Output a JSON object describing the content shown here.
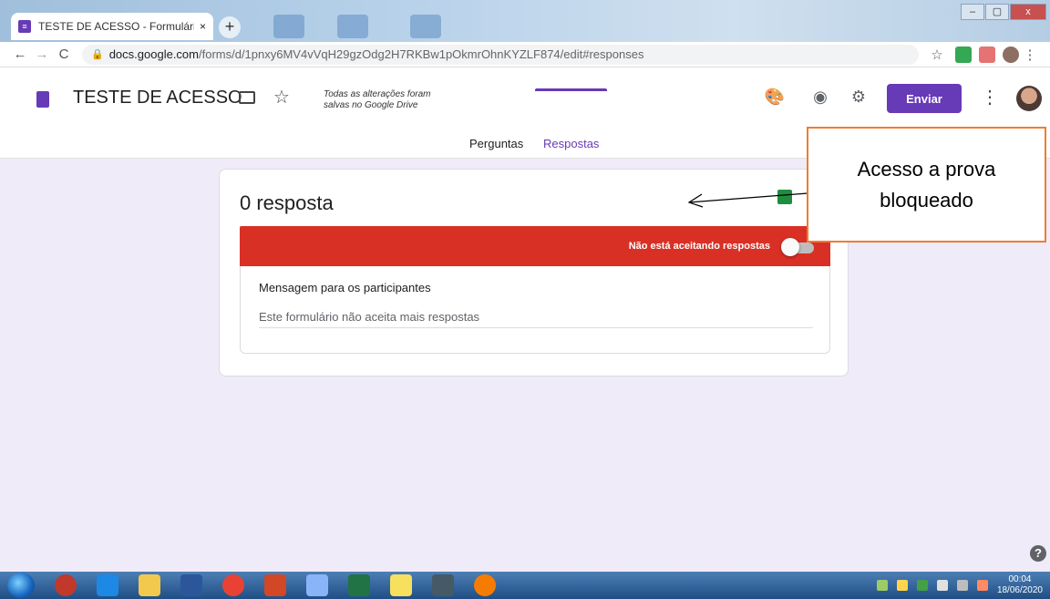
{
  "browser": {
    "tab_title": "TESTE DE ACESSO - Formulários (",
    "tab_close": "×",
    "new_tab": "+",
    "url_host": "docs.google.com",
    "url_path": "/forms/d/1pnxy6MV4vVqH29gzOdg2H7RKBw1pOkmrOhnKYZLF874/edit#responses",
    "window_buttons": {
      "minimize": "–",
      "maximize": "▢",
      "close": "x"
    }
  },
  "form": {
    "title": "TESTE DE ACESSO",
    "saved_message": "Todas as alterações foram salvas no Google Drive",
    "send_label": "Enviar",
    "tabs": [
      {
        "label": "Perguntas",
        "active": false
      },
      {
        "label": "Respostas",
        "active": true
      }
    ]
  },
  "responses": {
    "count_label": "0 resposta",
    "banner_text": "Não está aceitando respostas",
    "accepting": false,
    "message_label": "Mensagem para os participantes",
    "message_value": "Este formulário não aceita mais respostas"
  },
  "annotation": {
    "text": "Acesso a prova bloqueado"
  },
  "taskbar": {
    "time": "00:04",
    "date": "18/06/2020"
  },
  "colors": {
    "accent": "#673ab7",
    "banner": "#d93025",
    "callout_border": "#ed7d31"
  },
  "icons": [
    "back-icon",
    "forward-icon",
    "reload-icon",
    "lock-icon",
    "star-icon",
    "palette-icon",
    "eye-icon",
    "gear-icon",
    "more-icon",
    "folder-icon",
    "sheets-icon",
    "help-icon"
  ]
}
